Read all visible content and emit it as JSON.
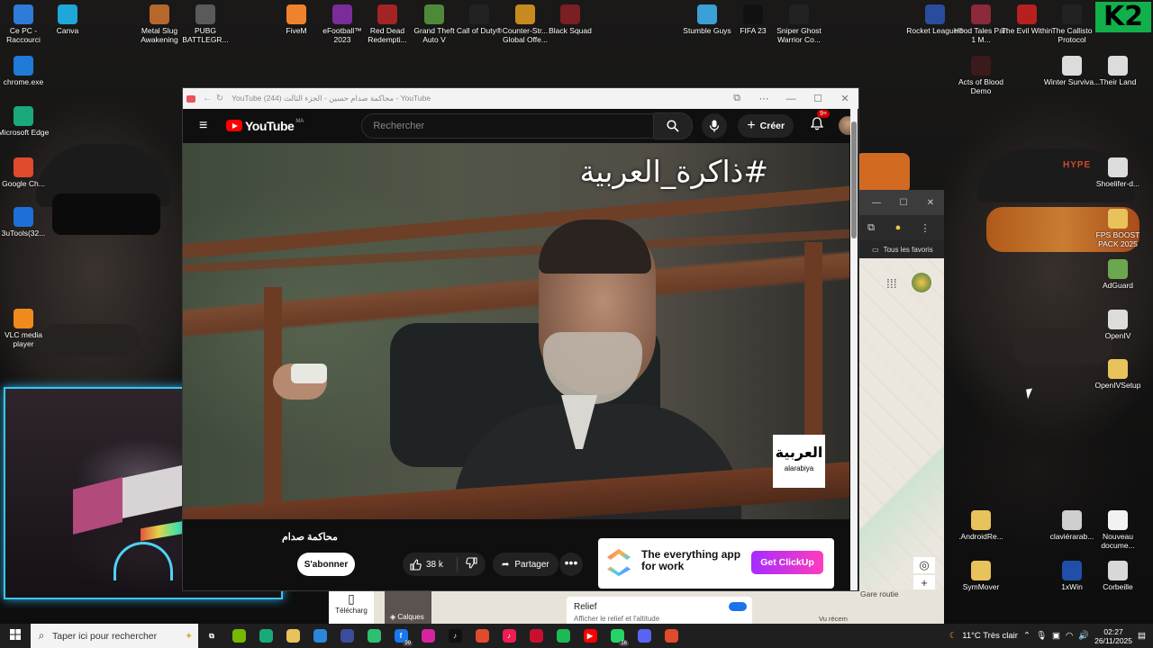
{
  "desktop_icons": [
    {
      "label": "Ce PC - Raccourci",
      "icon": "computer-icon",
      "color": "#2f7bd8"
    },
    {
      "label": "Canva",
      "icon": "canva-icon",
      "color": "#1fa7d8"
    },
    {
      "label": "Metal Slug Awakening",
      "icon": "game-icon",
      "color": "#b5672c"
    },
    {
      "label": "PUBG BATTLEGR...",
      "icon": "helmet-icon",
      "color": "#5a5a5a"
    },
    {
      "label": "FiveM",
      "icon": "fivem-icon",
      "color": "#f0822d"
    },
    {
      "label": "eFootball™ 2023",
      "icon": "game-icon",
      "color": "#7a2c9a"
    },
    {
      "label": "Red Dead Redempti...",
      "icon": "game-icon",
      "color": "#a32424"
    },
    {
      "label": "Grand Theft Auto V",
      "icon": "game-icon",
      "color": "#4c8a3a"
    },
    {
      "label": "Call of Duty®",
      "icon": "game-icon",
      "color": "#222222"
    },
    {
      "label": "Counter-Str... Global Offe...",
      "icon": "game-icon",
      "color": "#c78a1e"
    },
    {
      "label": "Black Squad",
      "icon": "game-icon",
      "color": "#7a1f22"
    },
    {
      "label": "Stumble Guys",
      "icon": "game-icon",
      "color": "#3aa0d6"
    },
    {
      "label": "FIFA 23",
      "icon": "game-icon",
      "color": "#111111"
    },
    {
      "label": "Sniper Ghost Warrior Co...",
      "icon": "game-icon",
      "color": "#222222"
    },
    {
      "label": "Rocket League®",
      "icon": "game-icon",
      "color": "#2a4c9c"
    },
    {
      "label": "Hood Tales Part 1 M...",
      "icon": "game-icon",
      "color": "#8a2a3a"
    },
    {
      "label": "The Evil Within",
      "icon": "game-icon",
      "color": "#b81f1f"
    },
    {
      "label": "The Callisto Protocol",
      "icon": "game-icon",
      "color": "#222222"
    },
    {
      "label": "chrome.exe",
      "icon": "ie-icon",
      "color": "#1f7ad8"
    },
    {
      "label": "Microsoft Edge",
      "icon": "edge-icon",
      "color": "#1aa97a"
    },
    {
      "label": "Google Ch...",
      "icon": "chrome-icon",
      "color": "#e04a2d"
    },
    {
      "label": "3uTools(32...",
      "icon": "tools-icon",
      "color": "#1f6fd8"
    },
    {
      "label": "VLC media player",
      "icon": "vlc-icon",
      "color": "#f08a1d"
    },
    {
      "label": "Acts of Blood Demo",
      "icon": "game-icon",
      "color": "#3a1a1a"
    },
    {
      "label": "Winter Surviva...",
      "icon": "game-icon",
      "color": "#dcdcdc"
    },
    {
      "label": "Their Land",
      "icon": "game-icon",
      "color": "#dcdcdc"
    },
    {
      "label": "Shoelifer-d...",
      "icon": "app-icon",
      "color": "#dcdcdc"
    },
    {
      "label": "FPS BOOST PACK 2025",
      "icon": "folder-icon",
      "color": "#e8c25a"
    },
    {
      "label": "AdGuard",
      "icon": "shield-icon",
      "color": "#6aa84f"
    },
    {
      "label": "OpenIV",
      "icon": "app-icon",
      "color": "#dcdcdc"
    },
    {
      "label": "OpenIVSetup",
      "icon": "folder-icon",
      "color": "#e8c25a"
    },
    {
      "label": ".AndroidRe...",
      "icon": "folder-icon",
      "color": "#e8c25a"
    },
    {
      "label": "SymMover",
      "icon": "folder-icon",
      "color": "#e8c25a"
    },
    {
      "label": "claviérarab...",
      "icon": "image-icon",
      "color": "#cfcfcf"
    },
    {
      "label": "Nouveau docume...",
      "icon": "document-icon",
      "color": "#f2f2f2"
    },
    {
      "label": "1xWin",
      "icon": "app-icon",
      "color": "#1f4fa8"
    },
    {
      "label": "Corbeille",
      "icon": "recycle-bin-icon",
      "color": "#d8d8d8"
    }
  ],
  "overlay_logo": "K2",
  "browser": {
    "tab_title": "YouTube (244) محاكمة صدام حسين - الجزء الثالث - YouTube",
    "yt_logo": "YouTube",
    "yt_region": "MA",
    "search_placeholder": "Rechercher",
    "create_label": "Créer",
    "notif_count": "9+",
    "video_overlay": "#ذاكرة_العربية",
    "channel_logo_ar": "العربية",
    "channel_logo_latin": "alarabiya",
    "video_title": "محاكمة صدام",
    "subscribe": "S'abonner",
    "likes": "38 k",
    "share": "Partager",
    "more": "•••",
    "ad": {
      "text": "The everything app for work",
      "cta": "Get ClickUp"
    }
  },
  "side_window": {
    "bookmarks": "Tous les favoris"
  },
  "map": {
    "telecharg": "Télécharg",
    "calques": "Calques",
    "relief_title": "Relief",
    "relief_sub": "Afficher le relief et l'altitude",
    "gare": "Gare routie",
    "vu": "Vu récem"
  },
  "taskbar": {
    "search_placeholder": "Taper ici pour rechercher",
    "weather": "11°C  Très clair",
    "time": "02:27",
    "date": "26/11/2025",
    "badges": {
      "facebook": "99",
      "whatsapp": "16"
    }
  }
}
